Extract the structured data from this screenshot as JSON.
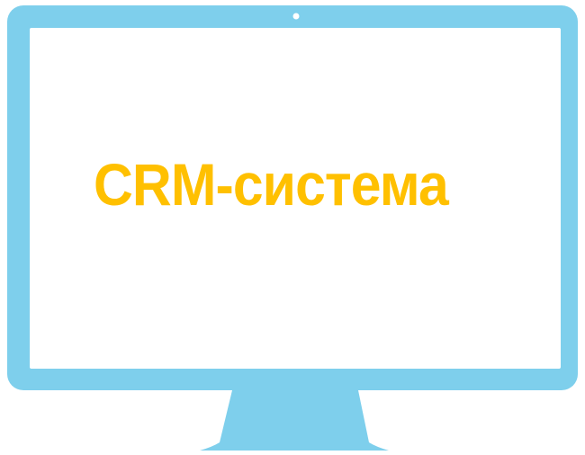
{
  "headline": {
    "text": "CRM-система"
  },
  "colors": {
    "monitor_frame": "#7ecfec",
    "screen": "#ffffff",
    "camera_dot": "#ffffff",
    "headline": "#ffc000"
  },
  "icons": {
    "camera": "camera-dot-icon",
    "stand": "monitor-stand-icon"
  }
}
